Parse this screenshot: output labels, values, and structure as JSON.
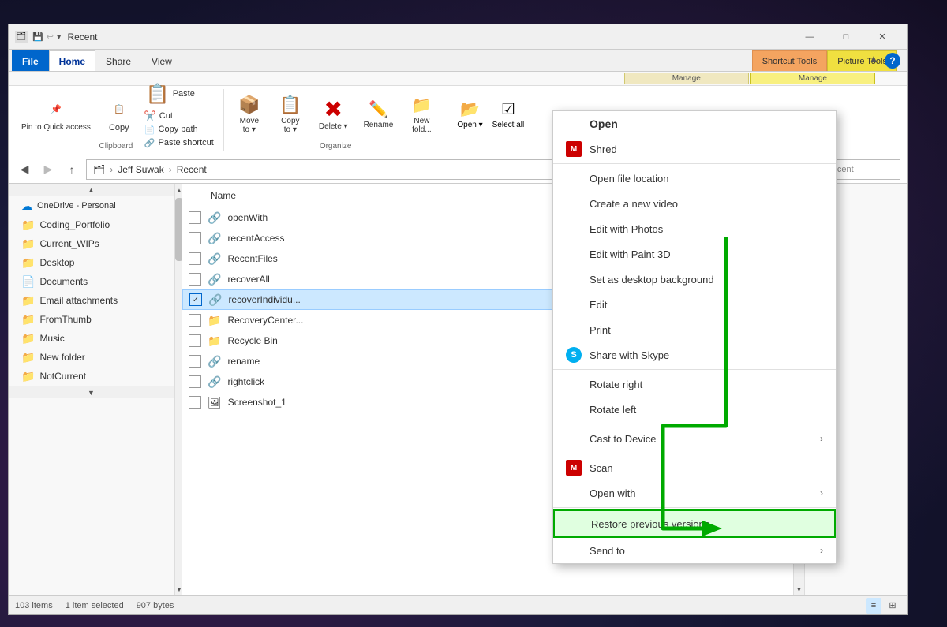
{
  "window": {
    "title": "Recent",
    "title_icon": "📁"
  },
  "title_bar": {
    "quick_save": "💾",
    "quick_undo": "↩",
    "chevron": "▾",
    "minimize": "—",
    "maximize": "□",
    "close": "✕"
  },
  "ribbon": {
    "tabs": [
      {
        "id": "file",
        "label": "File",
        "type": "file"
      },
      {
        "id": "home",
        "label": "Home",
        "type": "active"
      },
      {
        "id": "share",
        "label": "Share",
        "type": "normal"
      },
      {
        "id": "view",
        "label": "View",
        "type": "normal"
      },
      {
        "id": "shortcut-tools",
        "label": "Shortcut Tools",
        "type": "manage1"
      },
      {
        "id": "picture-tools",
        "label": "Picture Tools",
        "type": "manage2"
      },
      {
        "id": "manage1",
        "label": "Manage",
        "type": "manage-tab1"
      },
      {
        "id": "manage2",
        "label": "Manage",
        "type": "manage-tab2"
      }
    ],
    "sections": {
      "clipboard": {
        "label": "Clipboard",
        "pin_label": "Pin to Quick\naccess",
        "copy_label": "Copy",
        "paste_label": "Paste",
        "cut_label": "Cut",
        "copy_path_label": "Copy path",
        "paste_shortcut_label": "Paste shortcut"
      },
      "organize": {
        "label": "Organize",
        "move_to_label": "Move\nto ▾",
        "copy_to_label": "Copy\nto ▾",
        "delete_label": "Delete\n▾",
        "rename_label": "Rename",
        "new_folder_label": "New\nfold..."
      }
    }
  },
  "address": {
    "back_label": "◀",
    "forward_label": "▶",
    "up_label": "↑",
    "path_parts": [
      "Jeff Suwak",
      "Recent"
    ]
  },
  "sidebar": {
    "items": [
      {
        "id": "onedrive",
        "label": "OneDrive - Personal",
        "icon": "☁",
        "type": "cloud"
      },
      {
        "id": "coding",
        "label": "Coding_Portfolio",
        "icon": "📁",
        "type": "folder-yellow"
      },
      {
        "id": "wips",
        "label": "Current_WIPs",
        "icon": "📁",
        "type": "folder-yellow"
      },
      {
        "id": "desktop",
        "label": "Desktop",
        "icon": "📁",
        "type": "folder-blue"
      },
      {
        "id": "documents",
        "label": "Documents",
        "icon": "📄",
        "type": "doc"
      },
      {
        "id": "email",
        "label": "Email attachments",
        "icon": "📁",
        "type": "folder-yellow"
      },
      {
        "id": "fromthumb",
        "label": "FromThumb",
        "icon": "📁",
        "type": "folder-yellow"
      },
      {
        "id": "music",
        "label": "Music",
        "icon": "📁",
        "type": "folder-yellow"
      },
      {
        "id": "newfolder",
        "label": "New folder",
        "icon": "📁",
        "type": "folder-yellow"
      },
      {
        "id": "notcurrent",
        "label": "NotCurrent",
        "icon": "📁",
        "type": "folder-yellow"
      }
    ]
  },
  "files": {
    "columns": [
      "Name"
    ],
    "items": [
      {
        "name": "openWith",
        "icon": "🔗",
        "selected": false,
        "checked": false
      },
      {
        "name": "recentAccess",
        "icon": "🔗",
        "selected": false,
        "checked": false
      },
      {
        "name": "RecentFiles",
        "icon": "🔗",
        "selected": false,
        "checked": false
      },
      {
        "name": "recoverAll",
        "icon": "🔗",
        "selected": false,
        "checked": false
      },
      {
        "name": "recoverIndividu...",
        "icon": "🔗",
        "selected": true,
        "checked": true
      },
      {
        "name": "RecoveryCenter...",
        "icon": "📁",
        "selected": false,
        "checked": false
      },
      {
        "name": "Recycle Bin",
        "icon": "📁",
        "selected": false,
        "checked": false
      },
      {
        "name": "rename",
        "icon": "🔗",
        "selected": false,
        "checked": false
      },
      {
        "name": "rightclick",
        "icon": "🔗",
        "selected": false,
        "checked": false
      },
      {
        "name": "Screenshot_1",
        "icon": "🖼",
        "selected": false,
        "checked": false
      }
    ]
  },
  "status": {
    "items_count": "103 items",
    "selected_text": "1 item selected",
    "size": "907 bytes"
  },
  "context_menu": {
    "items": [
      {
        "id": "open",
        "label": "Open",
        "bold": true,
        "icon": "",
        "has_arrow": false,
        "mcafee": false,
        "skype": false,
        "separator_after": false
      },
      {
        "id": "shred",
        "label": "Shred",
        "bold": false,
        "icon": "",
        "has_arrow": false,
        "mcafee": true,
        "skype": false,
        "separator_after": false
      },
      {
        "id": "open-file-location",
        "label": "Open file location",
        "bold": false,
        "icon": "",
        "has_arrow": false,
        "mcafee": false,
        "skype": false,
        "separator_after": false
      },
      {
        "id": "create-new-video",
        "label": "Create a new video",
        "bold": false,
        "icon": "",
        "has_arrow": false,
        "mcafee": false,
        "skype": false,
        "separator_after": false
      },
      {
        "id": "edit-photos",
        "label": "Edit with Photos",
        "bold": false,
        "icon": "",
        "has_arrow": false,
        "mcafee": false,
        "skype": false,
        "separator_after": false
      },
      {
        "id": "edit-paint3d",
        "label": "Edit with Paint 3D",
        "bold": false,
        "icon": "",
        "has_arrow": false,
        "mcafee": false,
        "skype": false,
        "separator_after": false
      },
      {
        "id": "set-desktop-bg",
        "label": "Set as desktop background",
        "bold": false,
        "icon": "",
        "has_arrow": false,
        "mcafee": false,
        "skype": false,
        "separator_after": false
      },
      {
        "id": "edit",
        "label": "Edit",
        "bold": false,
        "icon": "",
        "has_arrow": false,
        "mcafee": false,
        "skype": false,
        "separator_after": false
      },
      {
        "id": "print",
        "label": "Print",
        "bold": false,
        "icon": "",
        "has_arrow": false,
        "mcafee": false,
        "skype": false,
        "separator_after": false
      },
      {
        "id": "share-skype",
        "label": "Share with Skype",
        "bold": false,
        "icon": "",
        "has_arrow": false,
        "mcafee": false,
        "skype": true,
        "separator_after": true
      },
      {
        "id": "rotate-right",
        "label": "Rotate right",
        "bold": false,
        "icon": "",
        "has_arrow": false,
        "mcafee": false,
        "skype": false,
        "separator_after": false
      },
      {
        "id": "rotate-left",
        "label": "Rotate left",
        "bold": false,
        "icon": "",
        "has_arrow": false,
        "mcafee": false,
        "skype": false,
        "separator_after": true
      },
      {
        "id": "cast-device",
        "label": "Cast to Device",
        "bold": false,
        "icon": "",
        "has_arrow": true,
        "mcafee": false,
        "skype": false,
        "separator_after": true
      },
      {
        "id": "scan",
        "label": "Scan",
        "bold": false,
        "icon": "",
        "has_arrow": false,
        "mcafee": true,
        "skype": false,
        "separator_after": false
      },
      {
        "id": "open-with",
        "label": "Open with",
        "bold": false,
        "icon": "",
        "has_arrow": true,
        "mcafee": false,
        "skype": false,
        "separator_after": true
      },
      {
        "id": "restore-versions",
        "label": "Restore previous versions",
        "bold": false,
        "icon": "",
        "has_arrow": false,
        "mcafee": false,
        "skype": false,
        "highlighted": true,
        "separator_after": false
      },
      {
        "id": "send-to",
        "label": "Send to",
        "bold": false,
        "icon": "",
        "has_arrow": true,
        "mcafee": false,
        "skype": false,
        "separator_after": false
      }
    ]
  },
  "arrow": {
    "annotation": "green arrow pointing to Restore previous versions"
  }
}
